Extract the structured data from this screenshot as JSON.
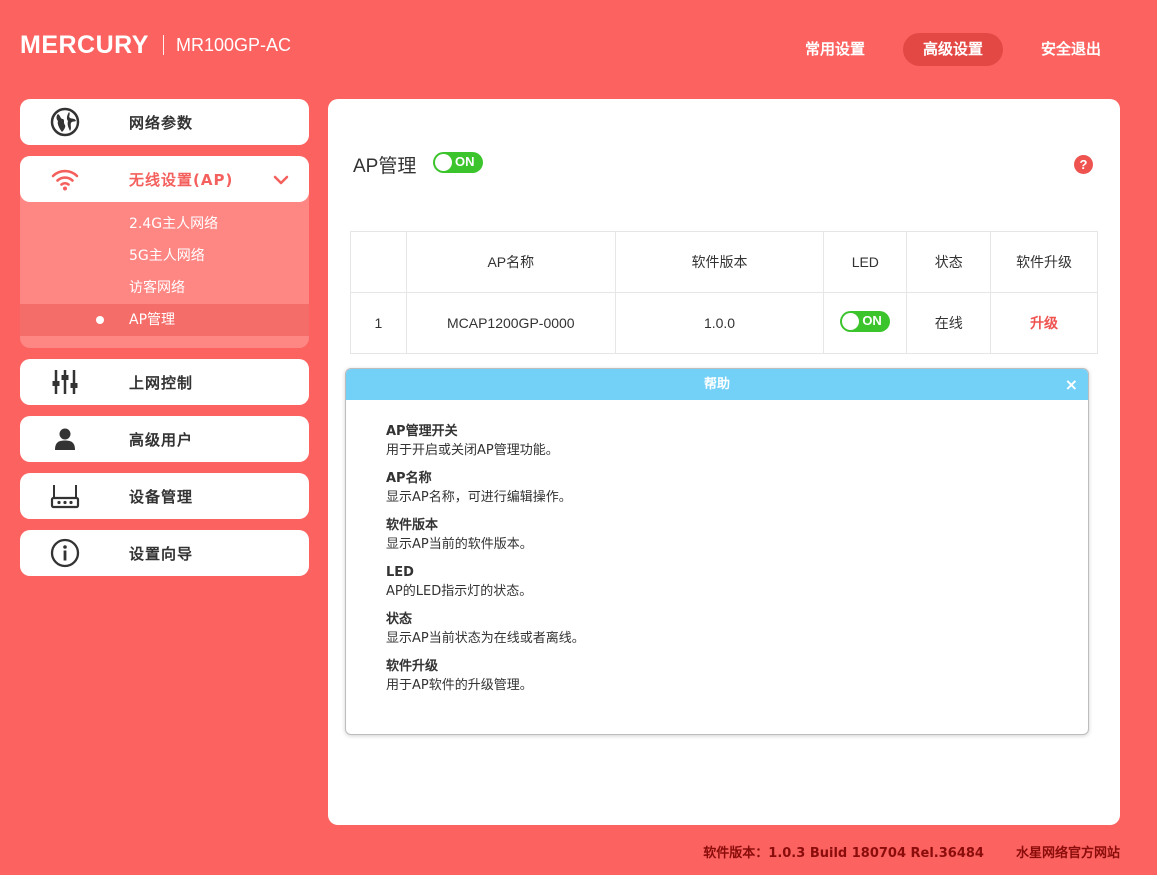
{
  "header": {
    "brand": "MERCURY",
    "model": "MR100GP-AC",
    "nav": [
      "常用设置",
      "高级设置",
      "安全退出"
    ]
  },
  "sidebar": {
    "items": [
      {
        "label": "网络参数",
        "icon": "globe-icon"
      },
      {
        "label": "无线设置(AP)",
        "icon": "wifi-icon"
      },
      {
        "label": "上网控制",
        "icon": "sliders-icon"
      },
      {
        "label": "高级用户",
        "icon": "user-icon"
      },
      {
        "label": "设备管理",
        "icon": "router-icon"
      },
      {
        "label": "设置向导",
        "icon": "info-icon"
      }
    ],
    "sub_items": [
      "2.4G主人网络",
      "5G主人网络",
      "访客网络",
      "AP管理"
    ]
  },
  "main": {
    "title": "AP管理",
    "toggle_label": "ON",
    "help_glyph": "?",
    "table": {
      "headers": [
        "",
        "AP名称",
        "软件版本",
        "LED",
        "状态",
        "软件升级"
      ],
      "rows": [
        {
          "index": "1",
          "name": "MCAP1200GP-0000",
          "version": "1.0.0",
          "led": "ON",
          "status": "在线",
          "upgrade": "升级"
        }
      ]
    }
  },
  "help": {
    "title": "帮助",
    "close": "×",
    "entries": [
      {
        "heading": "AP管理开关",
        "desc": "用于开启或关闭AP管理功能。"
      },
      {
        "heading": "AP名称",
        "desc": "显示AP名称，可进行编辑操作。"
      },
      {
        "heading": "软件版本",
        "desc": "显示AP当前的软件版本。"
      },
      {
        "heading": "LED",
        "desc": "AP的LED指示灯的状态。"
      },
      {
        "heading": "状态",
        "desc": "显示AP当前状态为在线或者离线。"
      },
      {
        "heading": "软件升级",
        "desc": "用于AP软件的升级管理。"
      }
    ]
  },
  "footer": {
    "version": "软件版本：1.0.3 Build 180704 Rel.36484",
    "link": "水星网络官方网站"
  },
  "colors": {
    "background": "#fb6260",
    "accent": "#ee5350",
    "toggle_on": "#3cc42d",
    "help_header": "#73d1f7"
  }
}
